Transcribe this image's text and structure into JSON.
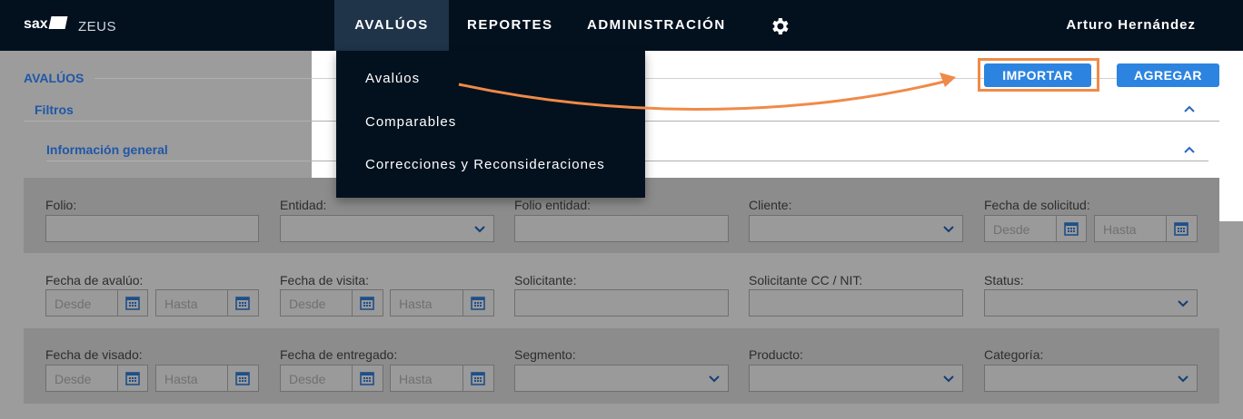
{
  "brand": {
    "logo": "sax",
    "app_name": "ZEUS"
  },
  "nav": {
    "items": [
      {
        "label": "AVALÚOS"
      },
      {
        "label": "REPORTES"
      },
      {
        "label": "ADMINISTRACIÓN"
      }
    ],
    "settings_icon": "gear-icon",
    "user": "Arturo Hernández"
  },
  "dropdown": {
    "items": [
      "Avalúos",
      "Comparables",
      "Correcciones y Reconsideraciones"
    ]
  },
  "page": {
    "title": "AVALÚOS",
    "filters_label": "Filtros",
    "general_info_label": "Información general",
    "import_button": "IMPORTAR",
    "add_button": "AGREGAR"
  },
  "filters": {
    "folio": "Folio:",
    "entidad": "Entidad:",
    "folio_entidad": "Folio entidad:",
    "cliente": "Cliente:",
    "fecha_solicitud": "Fecha de solicitud:",
    "fecha_avaluo": "Fecha de avalúo:",
    "fecha_visita": "Fecha de visita:",
    "solicitante": "Solicitante:",
    "solicitante_cc": "Solicitante CC / NIT:",
    "status": "Status:",
    "fecha_visado": "Fecha de visado:",
    "fecha_entregado": "Fecha de entregado:",
    "segmento": "Segmento:",
    "producto": "Producto:",
    "categoria": "Categoría:",
    "desde": "Desde",
    "hasta": "Hasta"
  },
  "colors": {
    "accent": "#2c84e0",
    "navbar": "#03111f",
    "highlight": "#f08a48"
  }
}
